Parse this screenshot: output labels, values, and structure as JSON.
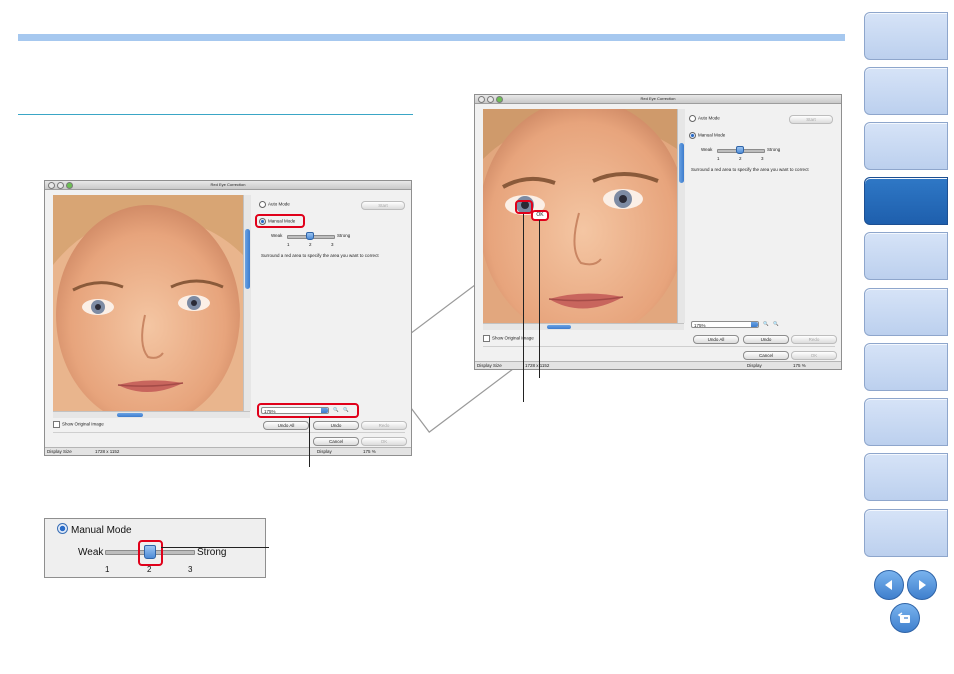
{
  "windows": [
    {
      "id": "left",
      "title": "Red Eye Correction",
      "auto_mode_label": "Auto Mode",
      "start_label": "Start",
      "manual_mode_label": "Manual Mode",
      "weak_label": "Weak",
      "strong_label": "Strong",
      "ticks": [
        "1",
        "2",
        "3"
      ],
      "instruction": "Surround a red area to specify the area you want to correct",
      "zoom_value": "175%",
      "undo_all_label": "Undo All",
      "undo_label": "Undo",
      "redo_label": "Redo",
      "show_original_label": "Show Original Image",
      "cancel_label": "Cancel",
      "ok_label": "OK",
      "status_left_label": "Display Size",
      "status_left_value": "1728 x 1152",
      "status_right_label": "Display",
      "status_right_value": "175 %"
    },
    {
      "id": "right",
      "title": "Red Eye Correction",
      "auto_mode_label": "Auto Mode",
      "start_label": "Start",
      "manual_mode_label": "Manual Mode",
      "weak_label": "Weak",
      "strong_label": "Strong",
      "ticks": [
        "1",
        "2",
        "3"
      ],
      "instruction": "Surround a red area to specify the area you want to correct",
      "zoom_value": "175%",
      "undo_all_label": "Undo All",
      "undo_label": "Undo",
      "redo_label": "Redo",
      "show_original_label": "Show Original Image",
      "cancel_label": "Cancel",
      "ok_label": "OK",
      "status_left_label": "Display Size",
      "status_left_value": "1728 x 1152",
      "status_right_label": "Display",
      "status_right_value": "175 %",
      "ok_badge": "OK"
    }
  ],
  "zoom_panel": {
    "manual_mode_label": "Manual Mode",
    "weak_label": "Weak",
    "strong_label": "Strong",
    "ticks": [
      "1",
      "2",
      "3"
    ],
    "slider_level": 2
  },
  "colors": {
    "accent_bar": "#a6c8ef",
    "highlight": "#e0001a",
    "nav_tab": "#c9d9f2",
    "nav_tab_active": "#2a6cc0"
  },
  "nav": {
    "tab_count": 10,
    "active_index": 3,
    "icons": [
      "previous-page-icon",
      "next-page-icon",
      "return-icon"
    ]
  }
}
